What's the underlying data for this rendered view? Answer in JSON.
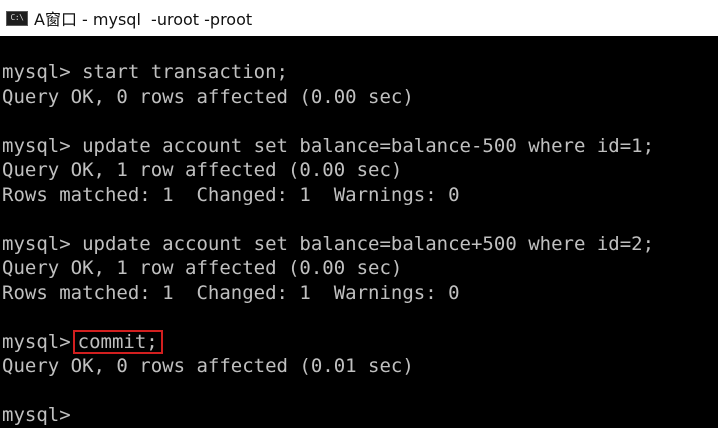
{
  "window": {
    "icon_text": "C:\\",
    "title": "A窗口 - mysql  -uroot -proot"
  },
  "console": {
    "lines": [
      "mysql> start transaction;",
      "Query OK, 0 rows affected (0.00 sec)",
      "",
      "mysql> update account set balance=balance-500 where id=1;",
      "Query OK, 1 row affected (0.00 sec)",
      "Rows matched: 1  Changed: 1  Warnings: 0",
      "",
      "mysql> update account set balance=balance+500 where id=2;",
      "Query OK, 1 row affected (0.00 sec)",
      "Rows matched: 1  Changed: 1  Warnings: 0",
      "",
      "mysql>",
      "Query OK, 0 rows affected (0.01 sec)",
      "",
      "mysql>"
    ],
    "highlighted_command": "commit;",
    "highlight_color": "#d21f1f"
  }
}
